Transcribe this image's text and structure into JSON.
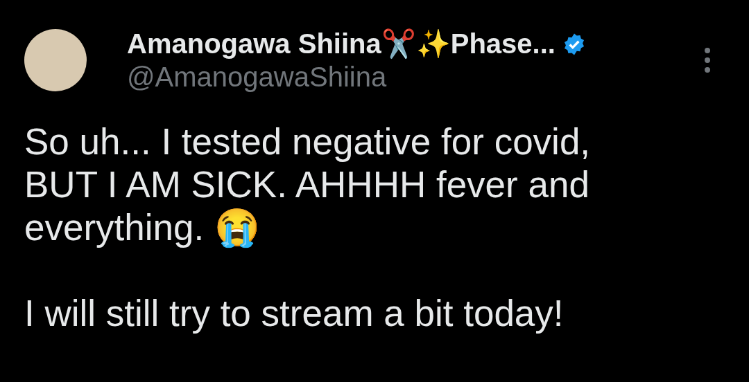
{
  "author": {
    "name": "Amanogawa Shiina✂️✨Phase...",
    "verified": true,
    "handle": "@AmanogawaShiina"
  },
  "body": [
    "So uh... I tested negative for covid, BUT I AM SICK. AHHHH fever and everything. 😭",
    "I will still try to stream a bit today!"
  ]
}
